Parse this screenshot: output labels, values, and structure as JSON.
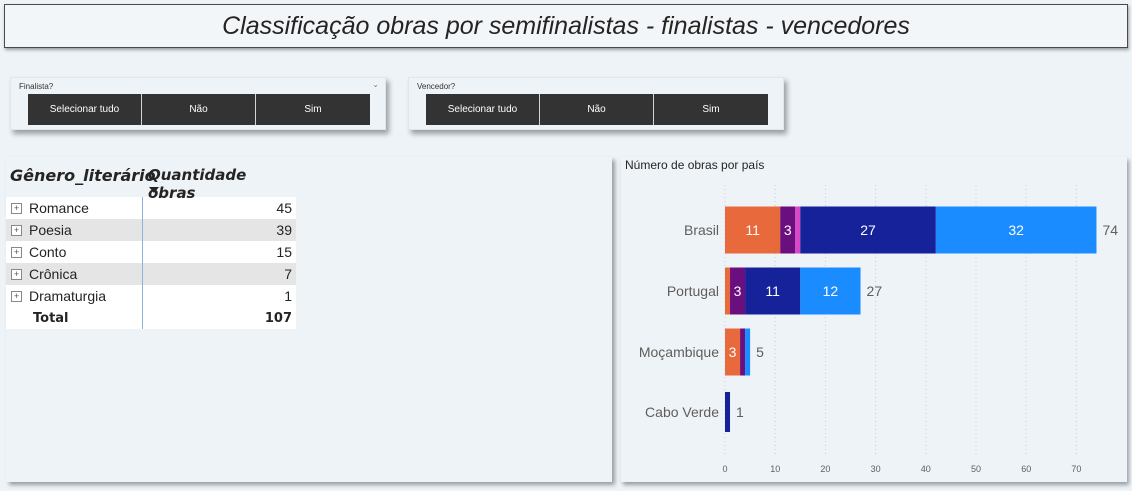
{
  "title": "Classificação obras por semifinalistas - finalistas - vencedores",
  "slicer_finalista": {
    "label": "Finalista?",
    "options": [
      "Selecionar tudo",
      "Não",
      "Sim"
    ]
  },
  "slicer_vencedor": {
    "label": "Vencedor?",
    "options": [
      "Selecionar tudo",
      "Não",
      "Sim"
    ]
  },
  "matrix": {
    "headers": [
      "Gênero_literário",
      "Quantidade obras"
    ],
    "rows": [
      {
        "genre": "Romance",
        "qty": "45"
      },
      {
        "genre": "Poesia",
        "qty": "39"
      },
      {
        "genre": "Conto",
        "qty": "15"
      },
      {
        "genre": "Crônica",
        "qty": "7"
      },
      {
        "genre": "Dramaturgia",
        "qty": "1"
      }
    ],
    "total_label": "Total",
    "total_value": "107",
    "expand_glyph": "+"
  },
  "chart_data": {
    "type": "bar",
    "orientation": "horizontal",
    "stacked": true,
    "title": "Número de obras por país",
    "categories": [
      "Brasil",
      "Portugal",
      "Moçambique",
      "Cabo Verde"
    ],
    "series": [
      {
        "color": "#e8693b",
        "values": [
          11,
          1,
          3,
          0
        ],
        "labels": [
          "11",
          "",
          "3",
          ""
        ]
      },
      {
        "color": "#6b0f7e",
        "values": [
          3,
          3,
          1,
          0
        ],
        "labels": [
          "3",
          "3",
          "",
          ""
        ]
      },
      {
        "color": "#d946c6",
        "values": [
          1,
          0,
          0,
          0
        ],
        "labels": [
          "",
          "",
          "",
          ""
        ]
      },
      {
        "color": "#16229a",
        "values": [
          27,
          11,
          0,
          1
        ],
        "labels": [
          "27",
          "11",
          "",
          ""
        ]
      },
      {
        "color": "#1a8cff",
        "values": [
          32,
          12,
          1,
          0
        ],
        "labels": [
          "32",
          "12",
          "",
          ""
        ]
      }
    ],
    "totals": [
      74,
      27,
      5,
      1
    ],
    "xlim": [
      0,
      75
    ],
    "xticks": [
      0,
      10,
      20,
      30,
      40,
      50,
      60,
      70
    ],
    "grid": true
  }
}
